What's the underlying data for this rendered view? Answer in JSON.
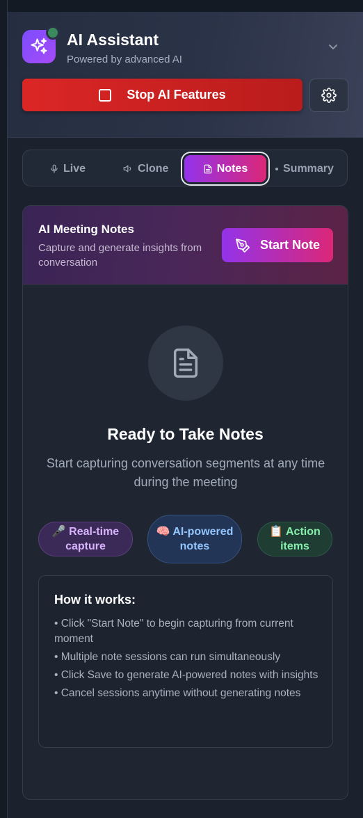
{
  "header": {
    "title": "AI Assistant",
    "subtitle": "Powered by advanced AI",
    "stop_label": "Stop AI Features"
  },
  "tabs": [
    {
      "label": "Live",
      "icon": "mic-icon",
      "active": false
    },
    {
      "label": "Clone",
      "icon": "speaker-icon",
      "active": false
    },
    {
      "label": "Notes",
      "icon": "document-icon",
      "active": true
    },
    {
      "label": "Summary",
      "icon": "dot-icon",
      "active": false
    }
  ],
  "notes_card": {
    "title": "AI Meeting Notes",
    "description": "Capture and generate insights from conversation",
    "start_label": "Start Note"
  },
  "empty_state": {
    "title": "Ready to Take Notes",
    "description": "Start capturing conversation segments at any time during the meeting"
  },
  "features": [
    {
      "label": "🎤 Real-time capture"
    },
    {
      "label": "🧠 AI-powered notes"
    },
    {
      "label": "📋 Action items"
    }
  ],
  "how_it_works": {
    "title": "How it works:",
    "items": [
      "Click \"Start Note\" to begin capturing from current moment",
      "Multiple note sessions can run simultaneously",
      "Click Save to generate AI-powered notes with insights",
      "Cancel sessions anytime without generating notes"
    ]
  },
  "colors": {
    "accent_purple": "#9333ea",
    "accent_pink": "#db2777",
    "danger": "#dc2626",
    "status_online": "#3b8a5e"
  }
}
